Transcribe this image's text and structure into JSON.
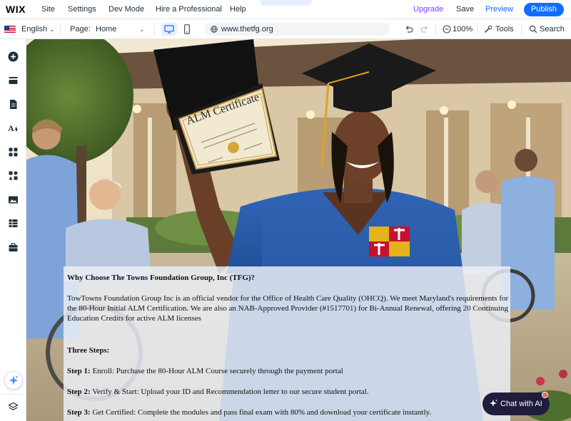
{
  "topbar": {
    "logo": "WIX",
    "menu": [
      "Site",
      "Settings",
      "Dev Mode",
      "Hire a Professional",
      "Help"
    ],
    "upgrade": "Upgrade",
    "save": "Save",
    "preview": "Preview",
    "publish": "Publish"
  },
  "subbar": {
    "language": "English",
    "page_label": "Page:",
    "page_value": "Home",
    "url": "www.thetfg.org",
    "zoom": "100%",
    "tools": "Tools",
    "search": "Search"
  },
  "left_toolbar": {
    "icons": [
      "add-elements-icon",
      "sections-icon",
      "pages-icon",
      "site-design-icon",
      "apps-icon",
      "business-tools-icon",
      "media-icon",
      "cms-icon",
      "portfolio-icon",
      "ai-assistant-icon",
      "layers-icon"
    ]
  },
  "hero": {
    "certificate_text": "ALM Certificate"
  },
  "content": {
    "heading": "Why Choose The Towns Foundation Group, Inc (TFG)?",
    "paragraph_lines": [
      "TowTowns Foundation Group Inc is an official vendor for the Office of Health Care Quality (OHCQ). We meet Maryland's requirements for",
      "the 80-Hour Initial ALM Certification. We are also an NAB-Approved Provider (#1517701) for Bi-Annual Renewal, offering 20 Continuing",
      "Education Credits for active ALM licenses"
    ],
    "steps_heading": "Three Steps:",
    "steps": [
      {
        "label": "Step 1:",
        "text": " Enroll: Purchase the 80-Hour ALM Course securely through the payment portal"
      },
      {
        "label": "Step 2:",
        "text": " Verify & Start: Upload your ID and Recommendation letter to our secure student portal."
      },
      {
        "label": "Step 3:",
        "text": " Get Certified: Complete the modules and pass final exam with 80% and download your certificate instantly."
      }
    ]
  },
  "chat": {
    "label": "Chat with AI"
  },
  "colors": {
    "accent": "#116dff",
    "upgrade": "#7d3cff",
    "chat_bg": "#1f1d3a"
  }
}
